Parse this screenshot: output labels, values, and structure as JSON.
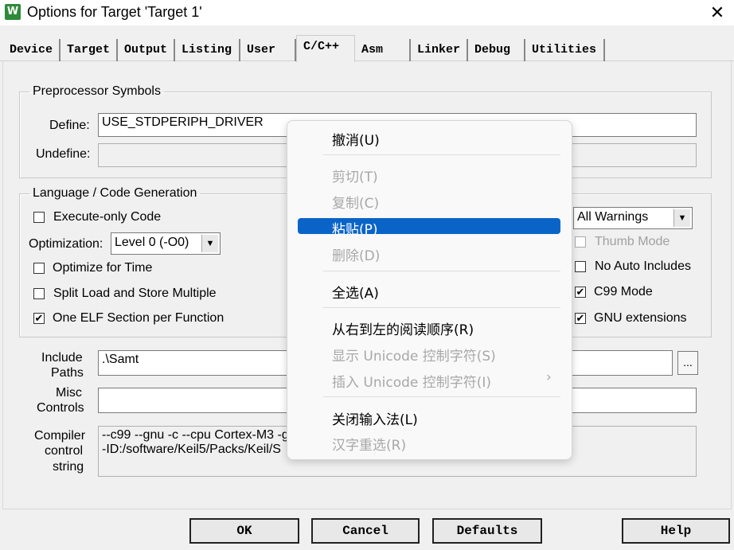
{
  "window": {
    "title": "Options for Target 'Target 1'",
    "icon_text": "W",
    "close_glyph": "✕"
  },
  "tabs": [
    {
      "label": "Device"
    },
    {
      "label": "Target"
    },
    {
      "label": "Output"
    },
    {
      "label": "Listing"
    },
    {
      "label": "User"
    },
    {
      "label": "C/C++",
      "active": true
    },
    {
      "label": "Asm"
    },
    {
      "label": "Linker"
    },
    {
      "label": "Debug"
    },
    {
      "label": "Utilities"
    }
  ],
  "preprocessor": {
    "legend": "Preprocessor Symbols",
    "define_label": "Define:",
    "define_value": "USE_STDPERIPH_DRIVER",
    "undefine_label": "Undefine:",
    "undefine_value": ""
  },
  "language": {
    "legend": "Language / Code Generation",
    "execute_only": {
      "label": "Execute-only Code",
      "checked": false
    },
    "optimization_label": "Optimization:",
    "optimization_value": "Level 0 (-O0)",
    "optimize_time": {
      "label": "Optimize for Time",
      "checked": false
    },
    "split_load": {
      "label": "Split Load and Store Multiple",
      "checked": false
    },
    "one_elf": {
      "label": "One ELF Section per Function",
      "checked": true
    },
    "warnings_value": "All Warnings",
    "thumb_mode": {
      "label": "Thumb Mode",
      "checked": false,
      "disabled": true
    },
    "no_auto_includes": {
      "label": "No Auto Includes",
      "checked": false
    },
    "c99_mode": {
      "label": "C99 Mode",
      "checked": true
    },
    "gnu_ext": {
      "label": "GNU extensions",
      "checked": true
    }
  },
  "paths": {
    "include_label_1": "Include",
    "include_label_2": "Paths",
    "include_value": ".\\Samt",
    "browse_label": "...",
    "misc_label_1": "Misc",
    "misc_label_2": "Controls",
    "misc_value": "",
    "compiler_label_1": "Compiler",
    "compiler_label_2": "control",
    "compiler_label_3": "string",
    "compiler_line_1": "--c99 --gnu -c --cpu Cortex-M3 -g",
    "compiler_line_2": "-ID:/software/Keil5/Packs/Keil/S"
  },
  "buttons": {
    "ok": "OK",
    "cancel": "Cancel",
    "defaults": "Defaults",
    "help": "Help"
  },
  "check_glyph": "✔",
  "dropdown_glyph": "▼",
  "context_menu": {
    "items": [
      {
        "label": "撤消(U)",
        "enabled": true
      },
      {
        "label": "剪切(T)",
        "enabled": false
      },
      {
        "label": "复制(C)",
        "enabled": false
      },
      {
        "label": "粘贴(P)",
        "enabled": true,
        "highlighted": true
      },
      {
        "label": "删除(D)",
        "enabled": false
      },
      {
        "label": "全选(A)",
        "enabled": true
      },
      {
        "label": "从右到左的阅读顺序(R)",
        "enabled": true
      },
      {
        "label": "显示 Unicode 控制字符(S)",
        "enabled": false
      },
      {
        "label": "插入 Unicode 控制字符(I)",
        "enabled": false,
        "submenu": true
      },
      {
        "label": "关闭输入法(L)",
        "enabled": true
      },
      {
        "label": "汉字重选(R)",
        "enabled": false
      }
    ],
    "submenu_glyph": "›"
  }
}
